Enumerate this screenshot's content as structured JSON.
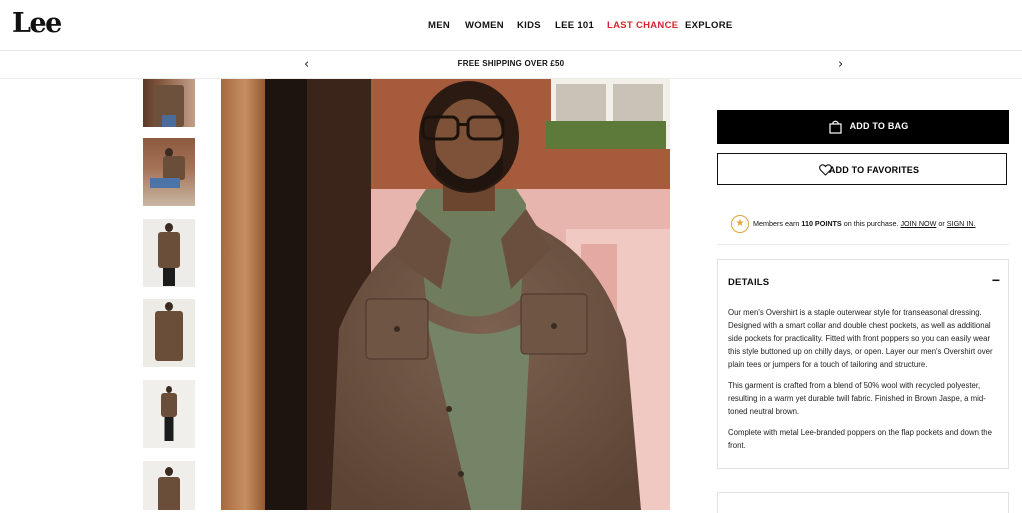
{
  "brand": {
    "logo": "Lee"
  },
  "nav": {
    "items": [
      {
        "label": "MEN"
      },
      {
        "label": "WOMEN"
      },
      {
        "label": "KIDS"
      },
      {
        "label": "LEE 101"
      },
      {
        "label": "LAST CHANCE",
        "color": "#d7262d"
      },
      {
        "label": "EXPLORE"
      }
    ]
  },
  "promo": {
    "text": "FREE SHIPPING OVER £50"
  },
  "product": {
    "add_to_bag": "ADD TO BAG",
    "add_to_favorites": "ADD TO FAVORITES",
    "members": {
      "prefix": "Members earn",
      "points": "110 POINTS",
      "middle": "on this purchase.",
      "join": "JOIN NOW",
      "or": "or",
      "signin": "SIGN IN."
    },
    "details": {
      "title": "DETAILS",
      "toggle": "−",
      "paragraphs": [
        "Our men's Overshirt is a staple outerwear style for transeasonal dressing. Designed with a smart collar and double chest pockets, as well as additional side pockets for practicality. Fitted with front poppers so you can easily wear this style buttoned up on chilly days, or open. Layer our men's Overshirt over plain tees or jumpers for a touch of tailoring and structure.",
        "This garment is crafted from a blend of 50% wool with recycled polyester, resulting in a warm yet durable twill fabric. Finished in Brown Jaspe, a mid-toned neutral brown.",
        "Complete with metal Lee-branded poppers on the flap pockets and down the front."
      ]
    }
  },
  "colors": {
    "accent_red": "#d7262d",
    "jacket_brown": "#6a4e39",
    "star_gold": "#e0a43a"
  }
}
